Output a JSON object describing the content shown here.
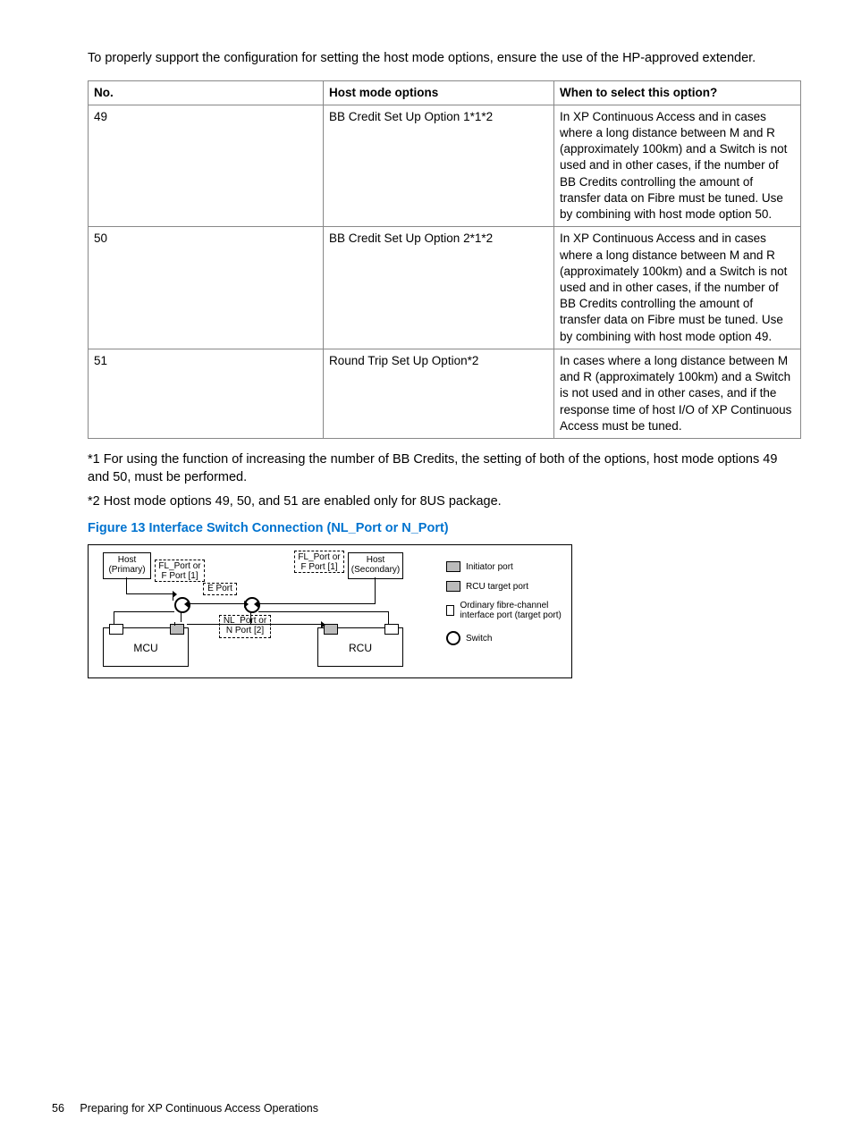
{
  "intro": "To properly support the configuration for setting the host mode options, ensure the use of the HP-approved extender.",
  "table": {
    "headers": {
      "no": "No.",
      "opt": "Host mode options",
      "when": "When to select this option?"
    },
    "rows": [
      {
        "no": "49",
        "opt": "BB Credit Set Up Option 1*1*2",
        "when": "In XP Continuous Access and in cases where a long distance between M and R (approximately 100km) and a Switch is not used and in other cases, if the number of BB Credits controlling the amount of transfer data on Fibre must be tuned. Use by combining with host mode option 50."
      },
      {
        "no": "50",
        "opt": "BB Credit Set Up Option 2*1*2",
        "when": "In XP Continuous Access and in cases where a long distance between M and R (approximately 100km) and a Switch is not used and in other cases, if the number of BB Credits controlling the amount of transfer data on Fibre must be tuned. Use by combining with host mode option 49."
      },
      {
        "no": "51",
        "opt": "Round Trip Set Up Option*2",
        "when": "In cases where a long distance between M and R (approximately 100km) and a Switch is not used and in other cases, and if the response time of host I/O of XP Continuous Access must be tuned."
      }
    ]
  },
  "note1": "*1 For using the function of increasing the number of BB Credits, the setting of both of the options, host mode options 49 and 50, must be performed.",
  "note2": "*2 Host mode options 49, 50, and 51 are enabled only for 8US package.",
  "figcap": "Figure 13 Interface Switch Connection (NL_Port or N_Port)",
  "diagram": {
    "host_primary": "Host (Primary)",
    "host_secondary": "Host (Secondary)",
    "fl_f_port": "FL_Port or F Port [1]",
    "e_port": "E Port",
    "nl_n_port": "NL_Port or N Port [2]",
    "mcu": "MCU",
    "rcu": "RCU",
    "legend": {
      "initiator": "Initiator port",
      "rcu_target": "RCU target port",
      "ordinary": "Ordinary fibre-channel interface port (target port)",
      "switch": "Switch"
    }
  },
  "footer": {
    "page": "56",
    "title": "Preparing for XP Continuous Access Operations"
  }
}
